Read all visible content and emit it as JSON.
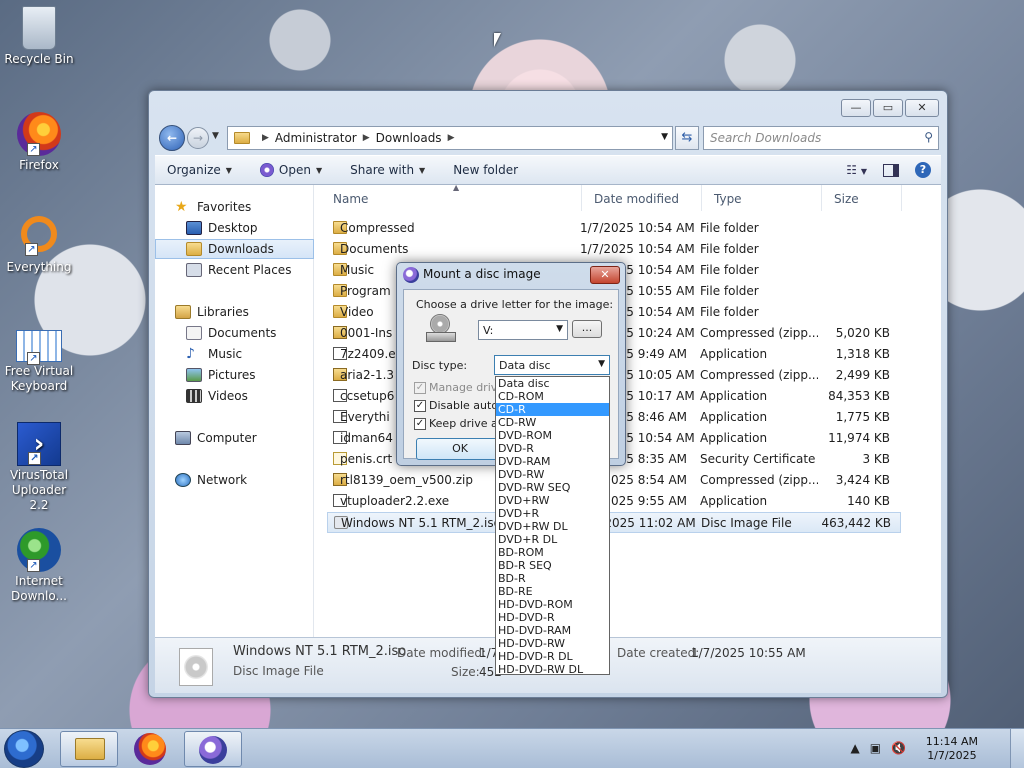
{
  "desktop": {
    "icons": [
      {
        "label": "Recycle Bin"
      },
      {
        "label": "Firefox"
      },
      {
        "label": "Everything"
      },
      {
        "label": "Free Virtual Keyboard"
      },
      {
        "label": "VirusTotal Uploader 2.2"
      },
      {
        "label": "Internet Downlo..."
      }
    ]
  },
  "explorer": {
    "caption_buttons": {
      "minimize": "▭",
      "maximize": "▭",
      "close": "✕"
    },
    "address": {
      "crumbs": [
        "Administrator",
        "Downloads"
      ]
    },
    "search_placeholder": "Search Downloads",
    "toolbar": {
      "organize": "Organize",
      "open": "Open",
      "share": "Share with",
      "new_folder": "New folder"
    },
    "nav": {
      "favorites": "Favorites",
      "desktop": "Desktop",
      "downloads": "Downloads",
      "recent": "Recent Places",
      "libraries": "Libraries",
      "documents": "Documents",
      "music": "Music",
      "pictures": "Pictures",
      "videos": "Videos",
      "computer": "Computer",
      "network": "Network"
    },
    "columns": {
      "name": "Name",
      "date": "Date modified",
      "type": "Type",
      "size": "Size"
    },
    "files": [
      {
        "name": "Compressed",
        "date": "1/7/2025 10:54 AM",
        "type": "File folder",
        "size": "",
        "kind": "folder"
      },
      {
        "name": "Documents",
        "date": "1/7/2025 10:54 AM",
        "type": "File folder",
        "size": "",
        "kind": "folder"
      },
      {
        "name": "Music",
        "date": "1/7/2025 10:54 AM",
        "type": "File folder",
        "size": "",
        "kind": "folder"
      },
      {
        "name": "Program",
        "date": "1/7/2025 10:55 AM",
        "type": "File folder",
        "size": "",
        "kind": "folder"
      },
      {
        "name": "Video",
        "date": "1/7/2025 10:54 AM",
        "type": "File folder",
        "size": "",
        "kind": "folder"
      },
      {
        "name": "0001-Ins",
        "date": "1/7/2025 10:24 AM",
        "type": "Compressed (zipp...",
        "size": "5,020 KB",
        "kind": "zip"
      },
      {
        "name": "7z2409.e",
        "date": "1/7/2025 9:49 AM",
        "type": "Application",
        "size": "1,318 KB",
        "kind": "app"
      },
      {
        "name": "aria2-1.3",
        "date": "1/7/2025 10:05 AM",
        "type": "Compressed (zipp...",
        "size": "2,499 KB",
        "kind": "zip"
      },
      {
        "name": "ccsetup6",
        "date": "1/7/2025 10:17 AM",
        "type": "Application",
        "size": "84,353 KB",
        "kind": "app"
      },
      {
        "name": "Everythi",
        "date": "1/7/2025 8:46 AM",
        "type": "Application",
        "size": "1,775 KB",
        "kind": "app"
      },
      {
        "name": "idman64",
        "date": "1/7/2025 10:54 AM",
        "type": "Application",
        "size": "11,974 KB",
        "kind": "app"
      },
      {
        "name": "penis.crt",
        "date": "1/7/2025 8:35 AM",
        "type": "Security Certificate",
        "size": "3 KB",
        "kind": "cert"
      },
      {
        "name": "rtl8139_oem_v500.zip",
        "date": "1/7/2025 8:54 AM",
        "type": "Compressed (zipp...",
        "size": "3,424 KB",
        "kind": "zip"
      },
      {
        "name": "vtuploader2.2.exe",
        "date": "1/7/2025 9:55 AM",
        "type": "Application",
        "size": "140 KB",
        "kind": "app"
      },
      {
        "name": "Windows NT 5.1 RTM_2.iso",
        "date": "1/7/2025 11:02 AM",
        "type": "Disc Image File",
        "size": "463,442 KB",
        "kind": "iso"
      }
    ],
    "details": {
      "filename": "Windows NT 5.1 RTM_2.iso",
      "filetype": "Disc Image File",
      "modified_label": "Date modified:",
      "modified_value": "1/7",
      "size_label": "Size:",
      "size_value": "452",
      "created_label": "Date created:",
      "created_value": "1/7/2025 10:55 AM"
    }
  },
  "dialog": {
    "title": "Mount a disc image",
    "close": "✕",
    "choose_label": "Choose a drive letter for the image:",
    "drive_value": "V:",
    "browse": "...",
    "disc_type_label": "Disc type:",
    "disc_type_value": "Data disc",
    "manage_drive": "Manage drive",
    "disable_auto": "Disable autor",
    "keep_drive": "Keep drive af",
    "ok": "OK",
    "options": [
      "Data disc",
      "CD-ROM",
      "CD-R",
      "CD-RW",
      "DVD-ROM",
      "DVD-R",
      "DVD-RAM",
      "DVD-RW",
      "DVD-RW SEQ",
      "DVD+RW",
      "DVD+R",
      "DVD+RW DL",
      "DVD+R DL",
      "BD-ROM",
      "BD-R SEQ",
      "BD-R",
      "BD-RE",
      "HD-DVD-ROM",
      "HD-DVD-R",
      "HD-DVD-RAM",
      "HD-DVD-RW",
      "HD-DVD-R DL",
      "HD-DVD-RW DL"
    ],
    "highlighted": "CD-R"
  },
  "taskbar": {
    "time": "11:14 AM",
    "date": "1/7/2025"
  }
}
